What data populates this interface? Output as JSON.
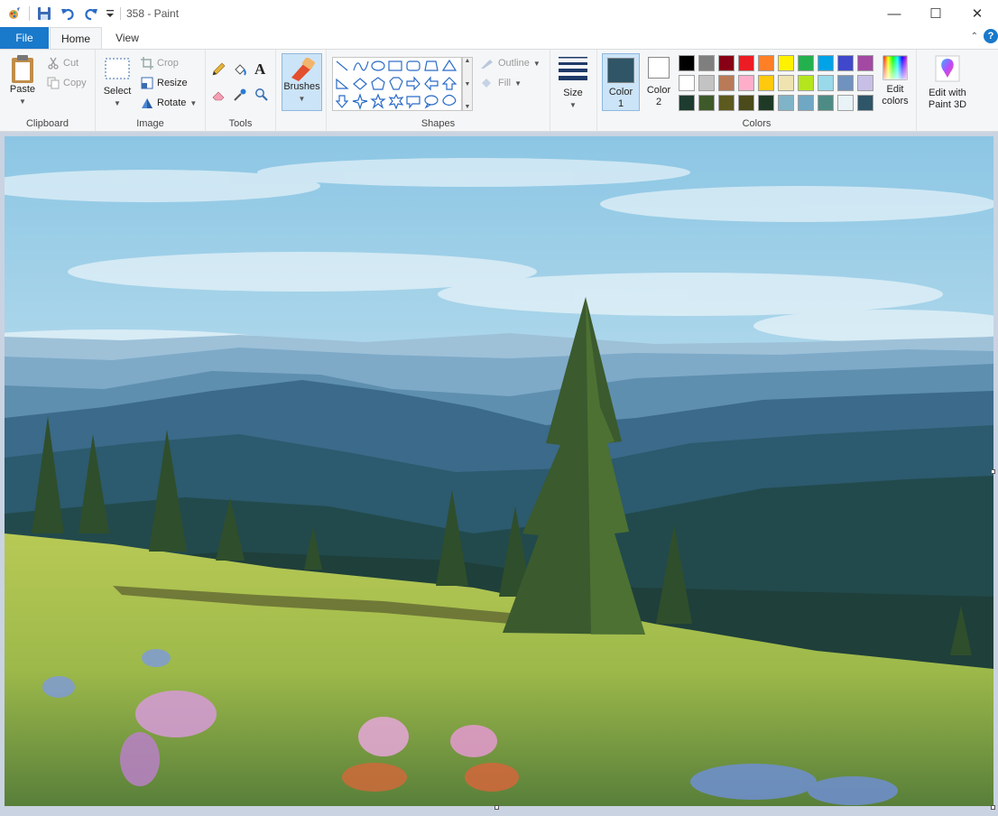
{
  "window": {
    "title": "358 - Paint"
  },
  "tabs": {
    "file": "File",
    "home": "Home",
    "view": "View"
  },
  "clipboard": {
    "paste": "Paste",
    "cut": "Cut",
    "copy": "Copy",
    "label": "Clipboard"
  },
  "image": {
    "select": "Select",
    "crop": "Crop",
    "resize": "Resize",
    "rotate": "Rotate",
    "label": "Image"
  },
  "tools": {
    "label": "Tools"
  },
  "brushes": {
    "label": "Brushes"
  },
  "shapes": {
    "outline": "Outline",
    "fill": "Fill",
    "label": "Shapes"
  },
  "size": {
    "label": "Size"
  },
  "colors": {
    "color1_line1": "Color",
    "color1_line2": "1",
    "color2_line1": "Color",
    "color2_line2": "2",
    "edit_colors_line1": "Edit",
    "edit_colors_line2": "colors",
    "label": "Colors",
    "color1_value": "#2f5567",
    "color2_value": "#ffffff",
    "palette_row1": [
      "#000000",
      "#7f7f7f",
      "#880015",
      "#ed1c24",
      "#ff7f27",
      "#fff200",
      "#22b14c",
      "#00a2e8",
      "#3f48cc",
      "#a349a4"
    ],
    "palette_row2": [
      "#ffffff",
      "#c3c3c3",
      "#b97a57",
      "#ffaec9",
      "#ffc90e",
      "#efe4b0",
      "#b5e61d",
      "#99d9ea",
      "#7092be",
      "#c8bfe7"
    ],
    "palette_row3": [
      "#1d3b2f",
      "#3f5a2a",
      "#5c5a1f",
      "#4a4a1a",
      "#1e3a26",
      "#7fb3c8",
      "#6fa7c4",
      "#4d8c84",
      "#e8f2f7",
      "#2e5568"
    ]
  },
  "paint3d": {
    "line1": "Edit with",
    "line2": "Paint 3D"
  }
}
